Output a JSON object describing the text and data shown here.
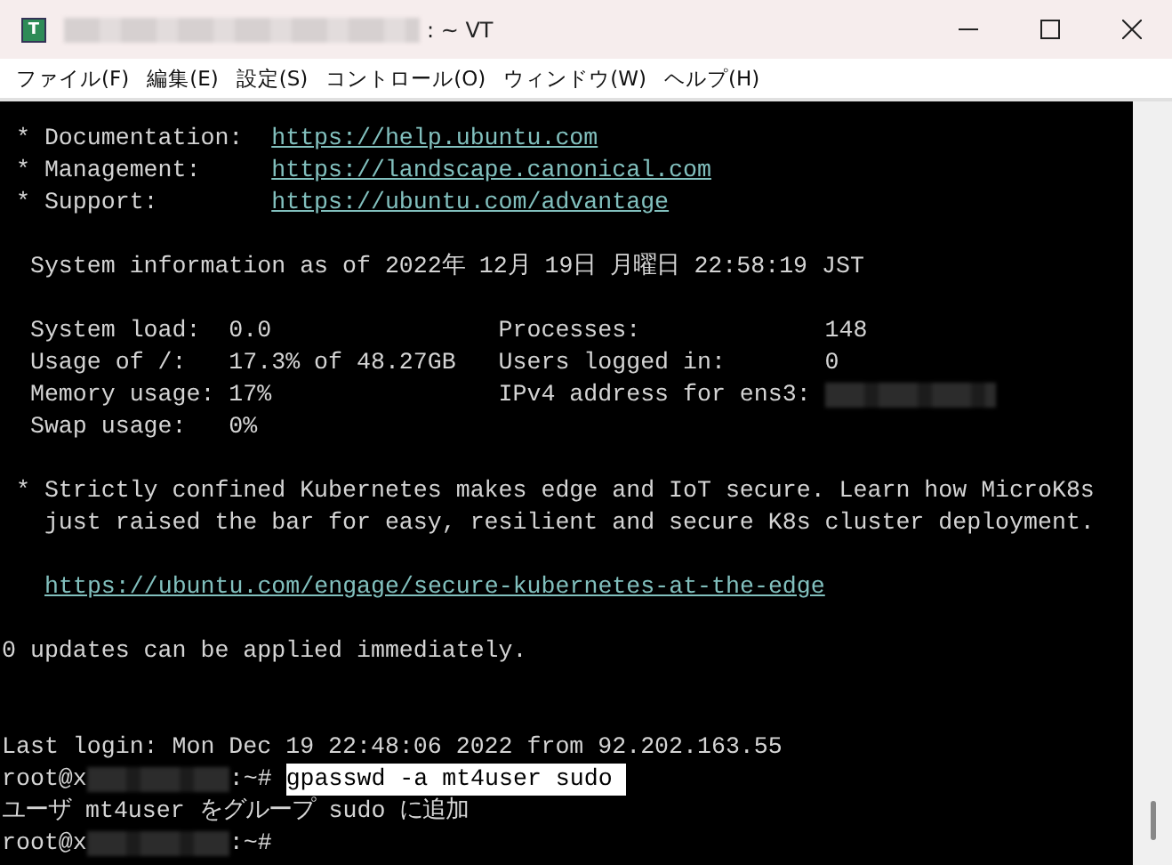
{
  "window": {
    "title": ": ~ VT",
    "icon_text": "T"
  },
  "menu": [
    "ファイル(F)",
    "編集(E)",
    "設定(S)",
    "コントロール(O)",
    "ウィンドウ(W)",
    "ヘルプ(H)"
  ],
  "terminal": {
    "lines": [
      {
        "kind": "text",
        "segments": [
          {
            "kind": "text",
            "text": " * Documentation:  "
          },
          {
            "kind": "link",
            "text": "https://help.ubuntu.com"
          }
        ]
      },
      {
        "kind": "text",
        "segments": [
          {
            "kind": "text",
            "text": " * Management:     "
          },
          {
            "kind": "link",
            "text": "https://landscape.canonical.com"
          }
        ]
      },
      {
        "kind": "text",
        "segments": [
          {
            "kind": "text",
            "text": " * Support:        "
          },
          {
            "kind": "link",
            "text": "https://ubuntu.com/advantage"
          }
        ]
      },
      {
        "kind": "blank"
      },
      {
        "kind": "text",
        "segments": [
          {
            "kind": "text",
            "text": "  System information as of 2022年 12月 19日 月曜日 22:58:19 JST"
          }
        ]
      },
      {
        "kind": "blank"
      },
      {
        "kind": "text",
        "segments": [
          {
            "kind": "text",
            "text": "  System load:  0.0                Processes:             148"
          }
        ]
      },
      {
        "kind": "text",
        "segments": [
          {
            "kind": "text",
            "text": "  Usage of /:   17.3% of 48.27GB   Users logged in:       0"
          }
        ]
      },
      {
        "kind": "text",
        "segments": [
          {
            "kind": "text",
            "text": "  Memory usage: 17%                IPv4 address for ens3: "
          },
          {
            "kind": "redacted_address"
          }
        ]
      },
      {
        "kind": "text",
        "segments": [
          {
            "kind": "text",
            "text": "  Swap usage:   0%"
          }
        ]
      },
      {
        "kind": "blank"
      },
      {
        "kind": "text",
        "segments": [
          {
            "kind": "text",
            "text": " * Strictly confined Kubernetes makes edge and IoT secure. Learn how MicroK8s"
          }
        ]
      },
      {
        "kind": "text",
        "segments": [
          {
            "kind": "text",
            "text": "   just raised the bar for easy, resilient and secure K8s cluster deployment."
          }
        ]
      },
      {
        "kind": "blank"
      },
      {
        "kind": "indented",
        "segments": [
          {
            "kind": "link",
            "text": "https://ubuntu.com/engage/secure-kubernetes-at-the-edge"
          }
        ]
      },
      {
        "kind": "blank"
      },
      {
        "kind": "text",
        "segments": [
          {
            "kind": "text",
            "text": "0 updates can be applied immediately."
          }
        ]
      },
      {
        "kind": "blank"
      },
      {
        "kind": "blank"
      },
      {
        "kind": "text",
        "segments": [
          {
            "kind": "text",
            "text": "Last login: Mon Dec 19 22:48:06 2022 from 92.202.163.55"
          }
        ]
      },
      {
        "kind": "text",
        "segments": [
          {
            "kind": "text",
            "text": "root@x"
          },
          {
            "kind": "redacted_host"
          },
          {
            "kind": "text",
            "text": ":~# "
          },
          {
            "kind": "selected",
            "text": "gpasswd -a mt4user sudo "
          }
        ]
      },
      {
        "kind": "text",
        "segments": [
          {
            "kind": "text",
            "text": "ユーザ mt4user をグループ sudo に追加"
          }
        ]
      },
      {
        "kind": "text",
        "segments": [
          {
            "kind": "text",
            "text": "root@x"
          },
          {
            "kind": "redacted_host"
          },
          {
            "kind": "text",
            "text": ":~#"
          }
        ]
      }
    ]
  }
}
